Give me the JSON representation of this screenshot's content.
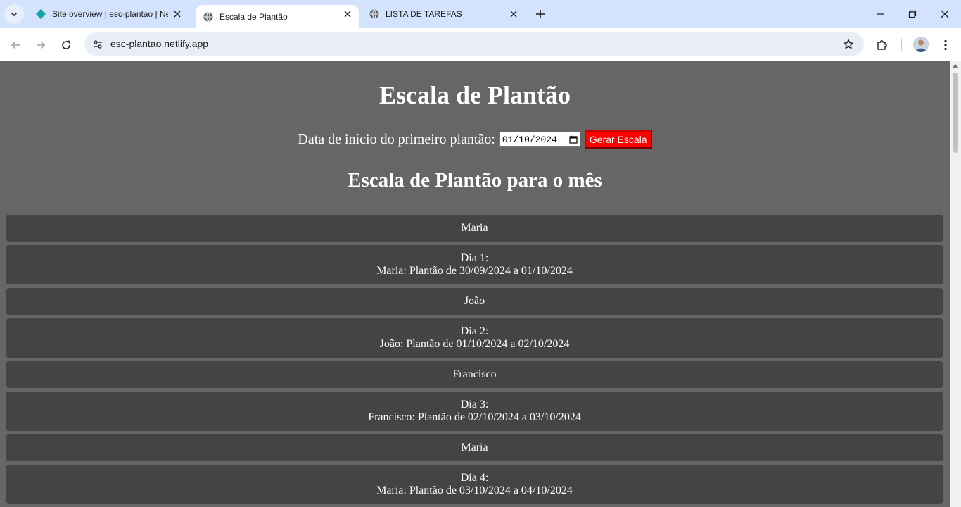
{
  "browser": {
    "tabs": [
      {
        "title": "Site overview | esc-plantao | Ne",
        "icon": "netlify-icon",
        "active": false
      },
      {
        "title": "Escala de Plantão",
        "icon": "globe-icon",
        "active": true
      },
      {
        "title": "LISTA DE TAREFAS",
        "icon": "globe-icon",
        "active": false
      }
    ],
    "url": "esc-plantao.netlify.app"
  },
  "page": {
    "title": "Escala de Plantão",
    "start_label": "Data de início do primeiro plantão:",
    "start_date": "01/10/2024",
    "generate_label": "Gerar Escala",
    "subtitle": "Escala de Plantão para o mês",
    "schedule": [
      {
        "name": "Maria",
        "day_label": "Dia 1:",
        "detail": "Maria: Plantão de 30/09/2024 a 01/10/2024"
      },
      {
        "name": "João",
        "day_label": "Dia 2:",
        "detail": "João: Plantão de 01/10/2024 a 02/10/2024"
      },
      {
        "name": "Francisco",
        "day_label": "Dia 3:",
        "detail": "Francisco: Plantão de 02/10/2024 a 03/10/2024"
      },
      {
        "name": "Maria",
        "day_label": "Dia 4:",
        "detail": "Maria: Plantão de 03/10/2024 a 04/10/2024"
      }
    ]
  },
  "colors": {
    "page_bg": "#666666",
    "card_bg": "#444444",
    "button_bg": "#ff0000",
    "tabbar_bg": "#d3e3fd"
  }
}
